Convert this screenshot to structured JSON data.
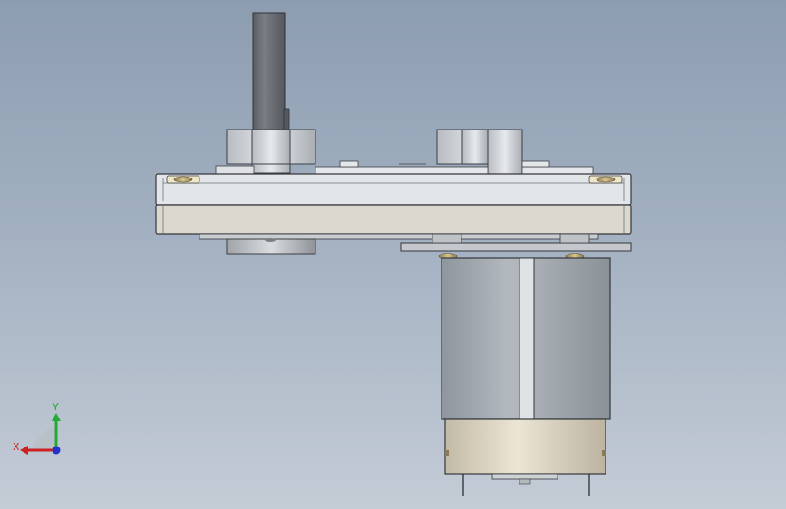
{
  "viewport": {
    "background_top": "#8d9db0",
    "background_bottom": "#c4ccd6"
  },
  "model": {
    "shaft_color": "#666a70",
    "housing_color": "#dcdfe3",
    "plate_color": "#d8d2c8",
    "motor_can_color": "#a6adb4",
    "motor_endcap_color": "#d9d2c0"
  },
  "triad": {
    "x_label": "X",
    "y_label": "Y",
    "x_color": "#cc2222",
    "y_color": "#22aa33",
    "z_color": "#2233cc",
    "icon": "coordinate-triad-icon"
  }
}
